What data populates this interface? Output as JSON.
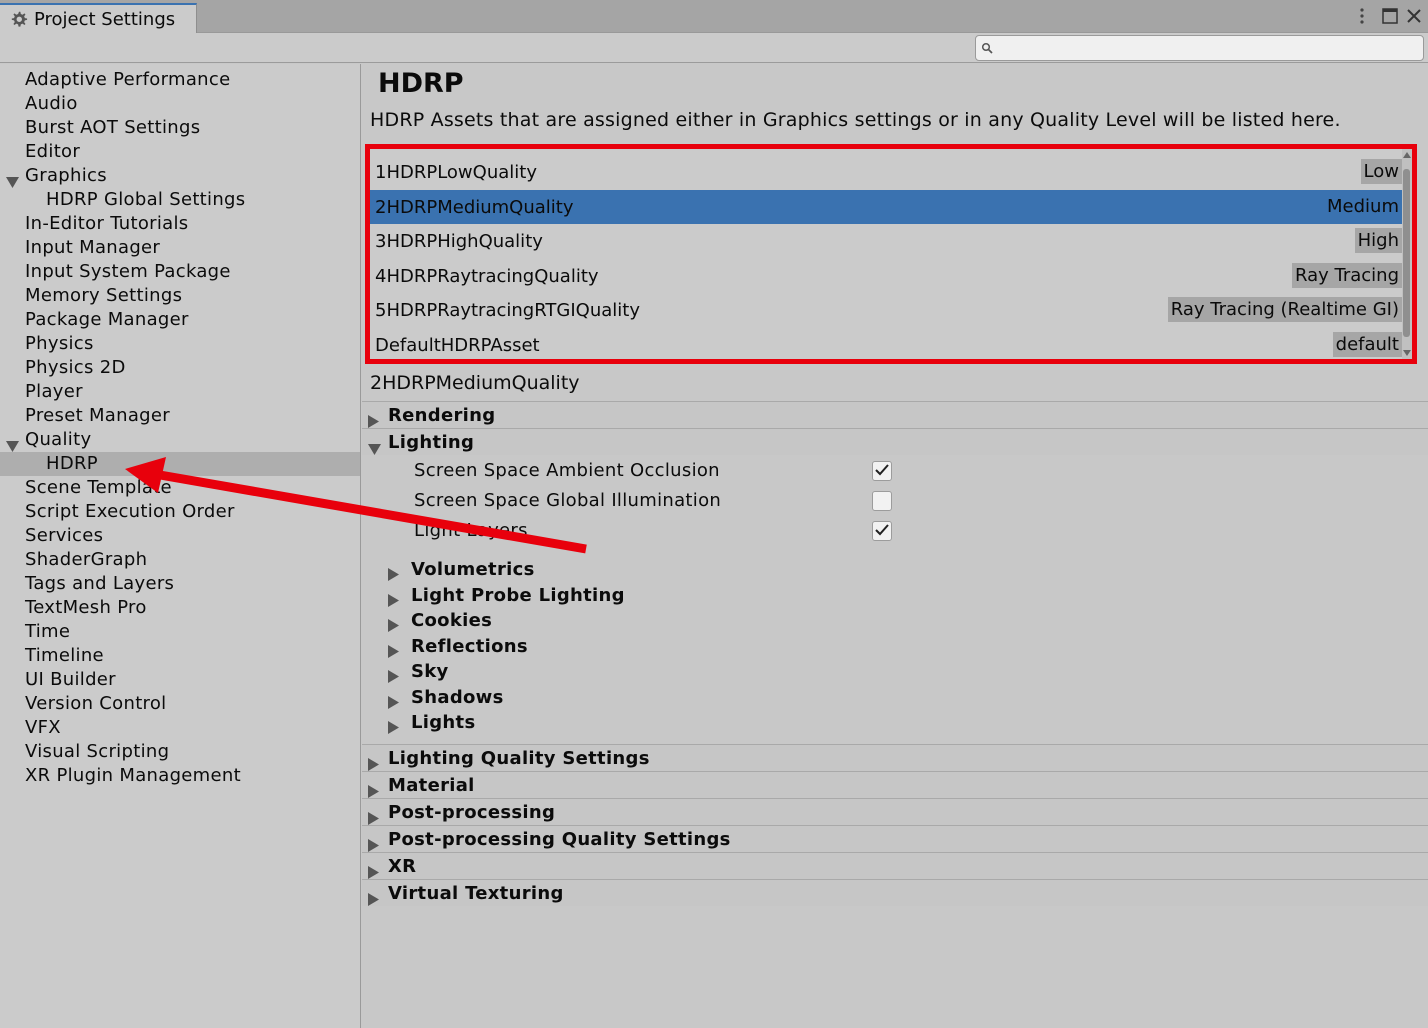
{
  "window": {
    "tab_title": "Project Settings",
    "tab_icon": "gear-icon"
  },
  "search": {
    "placeholder": "",
    "value": ""
  },
  "sidebar": {
    "items": [
      {
        "label": "Adaptive Performance",
        "indent": 0
      },
      {
        "label": "Audio",
        "indent": 0
      },
      {
        "label": "Burst AOT Settings",
        "indent": 0
      },
      {
        "label": "Editor",
        "indent": 0
      },
      {
        "label": "Graphics",
        "indent": 0,
        "expanded": true
      },
      {
        "label": "HDRP Global Settings",
        "indent": 1
      },
      {
        "label": "In-Editor Tutorials",
        "indent": 0
      },
      {
        "label": "Input Manager",
        "indent": 0
      },
      {
        "label": "Input System Package",
        "indent": 0
      },
      {
        "label": "Memory Settings",
        "indent": 0
      },
      {
        "label": "Package Manager",
        "indent": 0
      },
      {
        "label": "Physics",
        "indent": 0
      },
      {
        "label": "Physics 2D",
        "indent": 0
      },
      {
        "label": "Player",
        "indent": 0
      },
      {
        "label": "Preset Manager",
        "indent": 0
      },
      {
        "label": "Quality",
        "indent": 0,
        "expanded": true
      },
      {
        "label": "HDRP",
        "indent": 1,
        "selected": true
      },
      {
        "label": "Scene Template",
        "indent": 0
      },
      {
        "label": "Script Execution Order",
        "indent": 0
      },
      {
        "label": "Services",
        "indent": 0
      },
      {
        "label": "ShaderGraph",
        "indent": 0
      },
      {
        "label": "Tags and Layers",
        "indent": 0
      },
      {
        "label": "TextMesh Pro",
        "indent": 0
      },
      {
        "label": "Time",
        "indent": 0
      },
      {
        "label": "Timeline",
        "indent": 0
      },
      {
        "label": "UI Builder",
        "indent": 0
      },
      {
        "label": "Version Control",
        "indent": 0
      },
      {
        "label": "VFX",
        "indent": 0
      },
      {
        "label": "Visual Scripting",
        "indent": 0
      },
      {
        "label": "XR Plugin Management",
        "indent": 0
      }
    ]
  },
  "main": {
    "title": "HDRP",
    "description": "HDRP Assets that are assigned either in Graphics settings or in any Quality Level will be listed here.",
    "assets": [
      {
        "name": "1HDRPLowQuality",
        "level": "Low"
      },
      {
        "name": "2HDRPMediumQuality",
        "level": "Medium",
        "selected": true
      },
      {
        "name": "3HDRPHighQuality",
        "level": "High"
      },
      {
        "name": "4HDRPRaytracingQuality",
        "level": "Ray Tracing"
      },
      {
        "name": "5HDRPRaytracingRTGIQuality",
        "level": "Ray Tracing (Realtime GI)"
      },
      {
        "name": "DefaultHDRPAsset",
        "level": "default"
      }
    ],
    "selected_asset": "2HDRPMediumQuality",
    "sections_top": [
      {
        "label": "Rendering",
        "expanded": false
      },
      {
        "label": "Lighting",
        "expanded": true
      }
    ],
    "lighting_props": [
      {
        "label": "Screen Space Ambient Occlusion",
        "checked": true
      },
      {
        "label": "Screen Space Global Illumination",
        "checked": false
      },
      {
        "label": "Light Layers",
        "checked": true
      }
    ],
    "lighting_subsections": [
      {
        "label": "Volumetrics"
      },
      {
        "label": "Light Probe Lighting"
      },
      {
        "label": "Cookies"
      },
      {
        "label": "Reflections"
      },
      {
        "label": "Sky"
      },
      {
        "label": "Shadows"
      },
      {
        "label": "Lights"
      }
    ],
    "sections_bottom": [
      {
        "label": "Lighting Quality Settings"
      },
      {
        "label": "Material"
      },
      {
        "label": "Post-processing"
      },
      {
        "label": "Post-processing Quality Settings"
      },
      {
        "label": "XR"
      },
      {
        "label": "Virtual Texturing"
      }
    ]
  },
  "colors": {
    "selection_blue": "#3a72b0",
    "annotation_red": "#e8000c"
  }
}
